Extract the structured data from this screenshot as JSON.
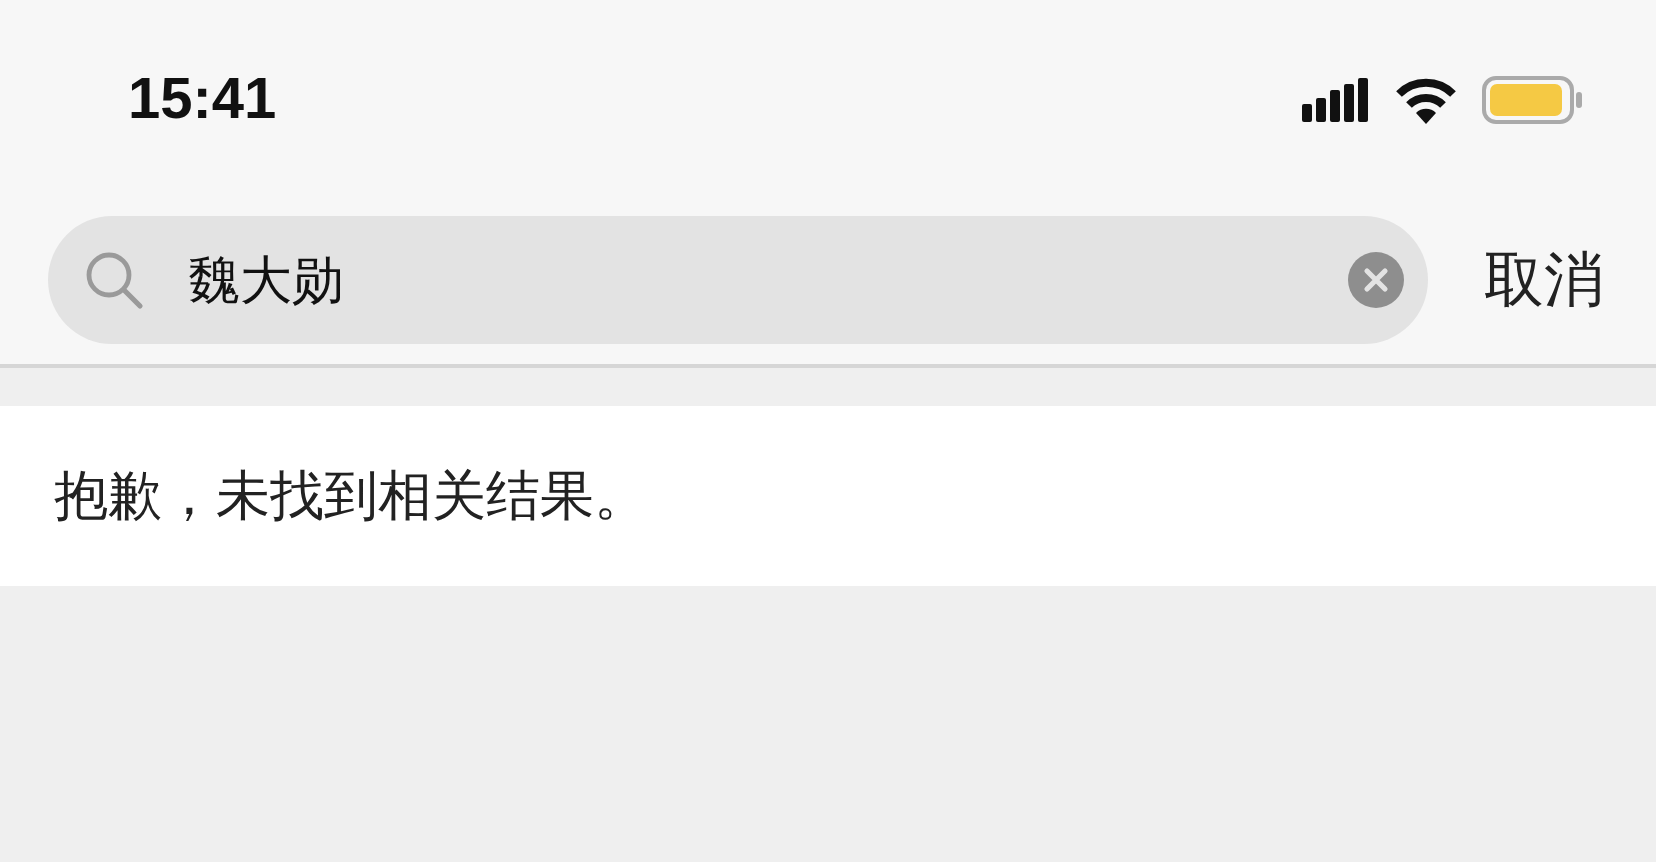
{
  "status_bar": {
    "time": "15:41"
  },
  "search": {
    "value": "魏大勋"
  },
  "cancel_button": "取消",
  "message": "抱歉，未找到相关结果。"
}
